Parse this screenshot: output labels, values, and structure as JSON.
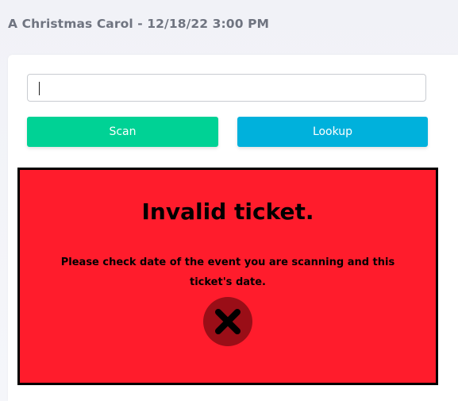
{
  "header": {
    "title": "A Christmas Carol - 12/18/22 3:00 PM"
  },
  "scanner": {
    "input_value": "",
    "scan_label": "Scan",
    "lookup_label": "Lookup"
  },
  "alert": {
    "title": "Invalid ticket.",
    "message": "Please check date of the event you are scanning and this ticket's date.",
    "icon": "x-circle-icon",
    "background_color": "#ff1c2c",
    "icon_circle_color": "#9a0e17"
  },
  "colors": {
    "scan_button": "#00d295",
    "lookup_button": "#00b1dc",
    "header_text": "#6f7480"
  }
}
